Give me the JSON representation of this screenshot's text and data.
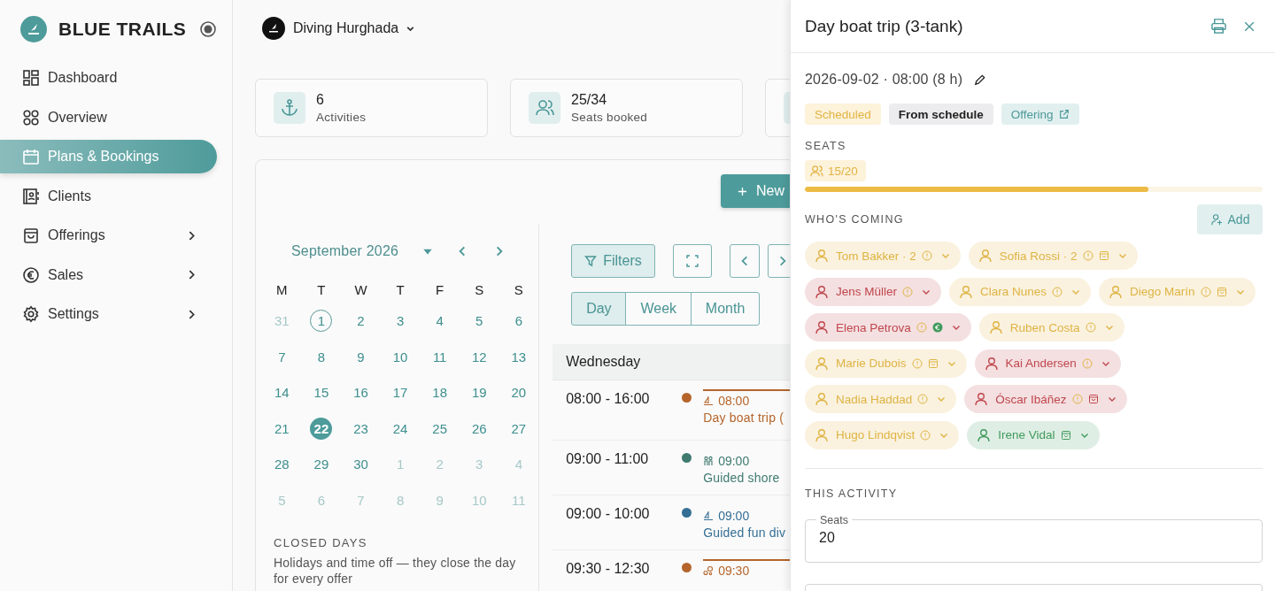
{
  "sidebar": {
    "brand": "BLUE TRAILS",
    "items": [
      {
        "label": "Dashboard",
        "selected": false,
        "expandable": false
      },
      {
        "label": "Overview",
        "selected": false,
        "expandable": false
      },
      {
        "label": "Plans & Bookings",
        "selected": true,
        "expandable": false
      },
      {
        "label": "Clients",
        "selected": false,
        "expandable": false
      },
      {
        "label": "Offerings",
        "selected": false,
        "expandable": true
      },
      {
        "label": "Sales",
        "selected": false,
        "expandable": true
      },
      {
        "label": "Settings",
        "selected": false,
        "expandable": true
      }
    ]
  },
  "header": {
    "organization": "Diving Hurghada"
  },
  "stats": [
    {
      "value": "6",
      "label": "Activities"
    },
    {
      "value": "25/34",
      "label": "Seats booked"
    }
  ],
  "new_button": "New",
  "calendar": {
    "month": "September 2026",
    "weekdays": [
      "M",
      "T",
      "W",
      "T",
      "F",
      "S",
      "S"
    ],
    "weeks": [
      [
        {
          "day": "31",
          "muted": true,
          "today": false,
          "selected": false
        },
        {
          "day": "1",
          "muted": false,
          "today": true,
          "selected": false
        },
        {
          "day": "2",
          "muted": false,
          "today": false,
          "selected": false
        },
        {
          "day": "3",
          "muted": false,
          "today": false,
          "selected": false
        },
        {
          "day": "4",
          "muted": false,
          "today": false,
          "selected": false
        },
        {
          "day": "5",
          "muted": false,
          "today": false,
          "selected": false
        },
        {
          "day": "6",
          "muted": false,
          "today": false,
          "selected": false
        }
      ],
      [
        {
          "day": "7",
          "muted": false,
          "today": false,
          "selected": false
        },
        {
          "day": "8",
          "muted": false,
          "today": false,
          "selected": false
        },
        {
          "day": "9",
          "muted": false,
          "today": false,
          "selected": false
        },
        {
          "day": "10",
          "muted": false,
          "today": false,
          "selected": false
        },
        {
          "day": "11",
          "muted": false,
          "today": false,
          "selected": false
        },
        {
          "day": "12",
          "muted": false,
          "today": false,
          "selected": false
        },
        {
          "day": "13",
          "muted": false,
          "today": false,
          "selected": false
        }
      ],
      [
        {
          "day": "14",
          "muted": false,
          "today": false,
          "selected": false
        },
        {
          "day": "15",
          "muted": false,
          "today": false,
          "selected": false
        },
        {
          "day": "16",
          "muted": false,
          "today": false,
          "selected": false
        },
        {
          "day": "17",
          "muted": false,
          "today": false,
          "selected": false
        },
        {
          "day": "18",
          "muted": false,
          "today": false,
          "selected": false
        },
        {
          "day": "19",
          "muted": false,
          "today": false,
          "selected": false
        },
        {
          "day": "20",
          "muted": false,
          "today": false,
          "selected": false
        }
      ],
      [
        {
          "day": "21",
          "muted": false,
          "today": false,
          "selected": false
        },
        {
          "day": "22",
          "muted": false,
          "today": false,
          "selected": true
        },
        {
          "day": "23",
          "muted": false,
          "today": false,
          "selected": false
        },
        {
          "day": "24",
          "muted": false,
          "today": false,
          "selected": false
        },
        {
          "day": "25",
          "muted": false,
          "today": false,
          "selected": false
        },
        {
          "day": "26",
          "muted": false,
          "today": false,
          "selected": false
        },
        {
          "day": "27",
          "muted": false,
          "today": false,
          "selected": false
        }
      ],
      [
        {
          "day": "28",
          "muted": false,
          "today": false,
          "selected": false
        },
        {
          "day": "29",
          "muted": false,
          "today": false,
          "selected": false
        },
        {
          "day": "30",
          "muted": false,
          "today": false,
          "selected": false
        },
        {
          "day": "1",
          "muted": true,
          "today": false,
          "selected": false
        },
        {
          "day": "2",
          "muted": true,
          "today": false,
          "selected": false
        },
        {
          "day": "3",
          "muted": true,
          "today": false,
          "selected": false
        },
        {
          "day": "4",
          "muted": true,
          "today": false,
          "selected": false
        }
      ],
      [
        {
          "day": "5",
          "muted": true,
          "today": false,
          "selected": false
        },
        {
          "day": "6",
          "muted": true,
          "today": false,
          "selected": false
        },
        {
          "day": "7",
          "muted": true,
          "today": false,
          "selected": false
        },
        {
          "day": "8",
          "muted": true,
          "today": false,
          "selected": false
        },
        {
          "day": "9",
          "muted": true,
          "today": false,
          "selected": false
        },
        {
          "day": "10",
          "muted": true,
          "today": false,
          "selected": false
        },
        {
          "day": "11",
          "muted": true,
          "today": false,
          "selected": false
        }
      ]
    ]
  },
  "closed_days": {
    "title": "CLOSED DAYS",
    "text": "Holidays and time off — they close the day for every offer"
  },
  "toolbar": {
    "filters": "Filters",
    "views": [
      {
        "label": "Day",
        "selected": true
      },
      {
        "label": "Week",
        "selected": false
      },
      {
        "label": "Month",
        "selected": false
      }
    ]
  },
  "day_view": {
    "heading": "Wednesday",
    "rows": [
      {
        "time": "08:00 - 16:00",
        "color": "#b5652b",
        "kind": "boat",
        "start": "08:00",
        "title": "Day boat trip (",
        "flagged": true
      },
      {
        "time": "09:00 - 11:00",
        "color": "#3f7a6f",
        "kind": "shore",
        "start": "09:00",
        "title": "Guided shore",
        "flagged": false
      },
      {
        "time": "09:00 - 10:00",
        "color": "#356f95",
        "kind": "boat",
        "start": "09:00",
        "title": "Guided fun div",
        "flagged": false
      },
      {
        "time": "09:30 - 12:30",
        "color": "#b5652b",
        "kind": "discover",
        "start": "09:30",
        "flagged": true
      }
    ]
  },
  "drawer": {
    "title": "Day boat trip (3-tank)",
    "when": "2026-09-02 · 08:00 (8 h)",
    "badges": [
      {
        "label": "Scheduled",
        "kind": "status"
      },
      {
        "label": "From schedule",
        "kind": "source"
      },
      {
        "label": "Offering",
        "kind": "link"
      }
    ],
    "seats_heading": "SEATS",
    "seats_badge": "15/20",
    "seats": {
      "level": 0.75
    },
    "attendees_heading": "WHO'S COMING",
    "add_button": "Add",
    "attendees": [
      {
        "name": "Tom Bakker · 2",
        "color": "#dfb343",
        "info": true,
        "bag": false,
        "paid": false
      },
      {
        "name": "Sofia Rossi · 2",
        "color": "#dfb343",
        "info": true,
        "bag": true,
        "paid": false
      },
      {
        "name": "Jens Müller",
        "color": "#c0464d",
        "info": true,
        "bag": false,
        "paid": false
      },
      {
        "name": "Clara Nunes",
        "color": "#dfb343",
        "info": true,
        "bag": false,
        "paid": false
      },
      {
        "name": "Diego Marín",
        "color": "#dfb343",
        "info": true,
        "bag": true,
        "paid": false
      },
      {
        "name": "Elena Petrova",
        "color": "#c0464d",
        "info": true,
        "bag": false,
        "paid": true
      },
      {
        "name": "Ruben Costa",
        "color": "#dfb343",
        "info": true,
        "bag": false,
        "paid": false
      },
      {
        "name": "Marie Dubois",
        "color": "#dfb343",
        "info": true,
        "bag": true,
        "paid": false
      },
      {
        "name": "Kai Andersen",
        "color": "#c0464d",
        "info": true,
        "bag": false,
        "paid": false
      },
      {
        "name": "Nadia Haddad",
        "color": "#dfb343",
        "info": true,
        "bag": false,
        "paid": false
      },
      {
        "name": "Óscar Ibáñez",
        "color": "#c0464d",
        "info": true,
        "bag": true,
        "paid": false
      },
      {
        "name": "Hugo Lindqvist",
        "color": "#dfb343",
        "info": true,
        "bag": false,
        "paid": false
      },
      {
        "name": "Irene Vidal",
        "color": "#3f9a5c",
        "info": false,
        "bag": true,
        "paid": false
      }
    ],
    "activity_heading": "THIS ACTIVITY",
    "seats_field": {
      "label": "Seats",
      "value": "20"
    }
  }
}
